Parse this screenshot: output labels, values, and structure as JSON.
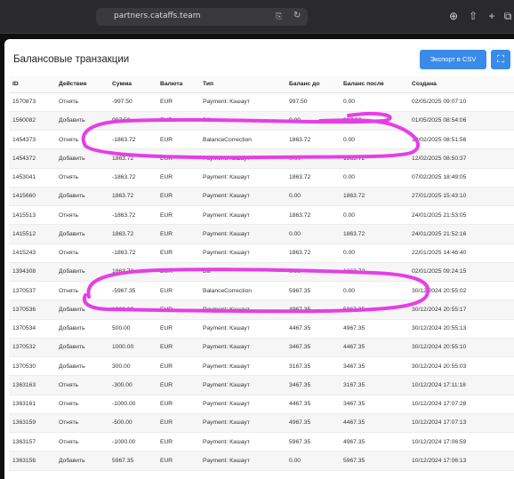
{
  "browser": {
    "url": "partners.cataffs.team",
    "translate_icon": "translate-icon",
    "reload_icon": "reload-icon",
    "download_icon": "download-icon",
    "share_icon": "share-icon",
    "new_tab_icon": "plus-icon",
    "tabs_icon": "tabs-overview-icon"
  },
  "panel": {
    "title": "Балансовые транзакции",
    "export_label": "Экспорт в CSV",
    "expand_icon": "expand-icon"
  },
  "table": {
    "columns": [
      "ID",
      "Действие",
      "Сумма",
      "Валюта",
      "Тип",
      "Баланс до",
      "Баланс после",
      "Создана"
    ],
    "rows": [
      [
        "1570873",
        "Отнять",
        "-997.50",
        "EUR",
        "Payment: Кэшаут",
        "997.50",
        "0.00",
        "02/05/2025 09:07:10"
      ],
      [
        "1560082",
        "Добавить",
        "997.50",
        "EUR",
        "Bill",
        "0.00",
        "997.50",
        "01/05/2025 08:54:06"
      ],
      [
        "1454373",
        "Отнять",
        "-1863.72",
        "EUR",
        "BalanceCorrection",
        "1863.72",
        "0.00",
        "12/02/2025 08:51:56"
      ],
      [
        "1454372",
        "Добавить",
        "1863.72",
        "EUR",
        "Payment: Кэшаут",
        "0.00",
        "1863.72",
        "12/02/2025 08:50:37"
      ],
      [
        "1453041",
        "Отнять",
        "-1863.72",
        "EUR",
        "Payment: Кэшаут",
        "1863.72",
        "0.00",
        "07/02/2025 18:49:05"
      ],
      [
        "1415660",
        "Добавить",
        "1863.72",
        "EUR",
        "Payment: Кэшаут",
        "0.00",
        "1863.72",
        "27/01/2025 15:43:10"
      ],
      [
        "1415513",
        "Отнять",
        "-1863.72",
        "EUR",
        "Payment: Кэшаут",
        "1863.72",
        "0.00",
        "24/01/2025 21:53:05"
      ],
      [
        "1415512",
        "Добавить",
        "1863.72",
        "EUR",
        "Payment: Кэшаут",
        "0.00",
        "1863.72",
        "24/01/2025 21:52:16"
      ],
      [
        "1415243",
        "Отнять",
        "-1863.72",
        "EUR",
        "Payment: Кэшаут",
        "1863.72",
        "0.00",
        "22/01/2025 14:46:40"
      ],
      [
        "1394308",
        "Добавить",
        "1863.72",
        "EUR",
        "Bill",
        "0.00",
        "1863.72",
        "02/01/2025 09:24:15"
      ],
      [
        "1370537",
        "Отнять",
        "-5967.35",
        "EUR",
        "BalanceCorrection",
        "5967.35",
        "0.00",
        "30/12/2024 20:55:02"
      ],
      [
        "1370536",
        "Добавить",
        "1000.00",
        "EUR",
        "Payment: Кэшаут",
        "4967.35",
        "5967.35",
        "30/12/2024 20:55:17"
      ],
      [
        "1370534",
        "Добавить",
        "500.00",
        "EUR",
        "Payment: Кэшаут",
        "4467.35",
        "4967.35",
        "30/12/2024 20:55:13"
      ],
      [
        "1370532",
        "Добавить",
        "1000.00",
        "EUR",
        "Payment: Кэшаут",
        "3467.35",
        "4467.35",
        "30/12/2024 20:55:10"
      ],
      [
        "1370530",
        "Добавить",
        "300.00",
        "EUR",
        "Payment: Кэшаут",
        "3167.35",
        "3467.35",
        "30/12/2024 20:55:03"
      ],
      [
        "1363163",
        "Отнять",
        "-300.00",
        "EUR",
        "Payment: Кэшаут",
        "3467.35",
        "3167.35",
        "10/12/2024 17:11:18"
      ],
      [
        "1363161",
        "Отнять",
        "-1000.00",
        "EUR",
        "Payment: Кэшаут",
        "4467.35",
        "3467.35",
        "10/12/2024 17:07:28"
      ],
      [
        "1363159",
        "Отнять",
        "-500.00",
        "EUR",
        "Payment: Кэшаут",
        "4967.35",
        "4467.35",
        "10/12/2024 17:07:13"
      ],
      [
        "1363157",
        "Отнять",
        "-1000.00",
        "EUR",
        "Payment: Кэшаут",
        "5967.35",
        "4967.35",
        "10/12/2024 17:06:59"
      ],
      [
        "1363156",
        "Добавить",
        "5967.35",
        "EUR",
        "Payment: Кэшаут",
        "0.00",
        "5967.35",
        "10/12/2024 17:06:13"
      ]
    ]
  },
  "colors": {
    "accent": "#3a8be8",
    "highlight_marker": "#e63ee6"
  }
}
